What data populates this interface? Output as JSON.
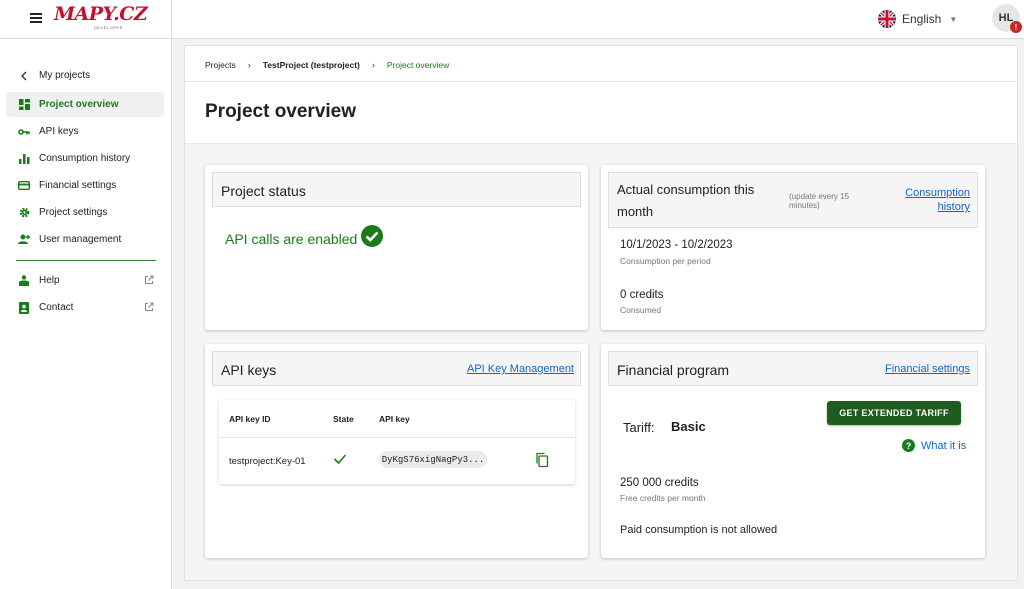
{
  "header": {
    "logo_text": "MAPY.CZ",
    "logo_sub": "DEVELOPER",
    "language": "English",
    "user_initials": "HL",
    "alert_badge": "!"
  },
  "sidebar": {
    "items": [
      {
        "label": "My projects",
        "icon": "chevron-left-icon"
      },
      {
        "label": "Project overview",
        "icon": "dashboard-icon"
      },
      {
        "label": "API keys",
        "icon": "key-icon"
      },
      {
        "label": "Consumption history",
        "icon": "bar-chart-icon"
      },
      {
        "label": "Financial settings",
        "icon": "credit-card-icon"
      },
      {
        "label": "Project settings",
        "icon": "gear-icon"
      },
      {
        "label": "User management",
        "icon": "user-management-icon"
      },
      {
        "label": "Help",
        "icon": "help-icon"
      },
      {
        "label": "Contact",
        "icon": "contact-icon"
      }
    ]
  },
  "breadcrumb": {
    "projects": "Projects",
    "project": "TestProject (testproject)",
    "current": "Project overview"
  },
  "page_title": "Project overview",
  "project_status": {
    "title": "Project status",
    "status_text": "API calls are enabled"
  },
  "consumption": {
    "title_line1": "Actual consumption this",
    "title_line2": "month",
    "note": "(update every 15 minutes)",
    "link_line1": "Consumption",
    "link_line2": "history",
    "period": "10/1/2023 - 10/2/2023",
    "period_label": "Consumption per period",
    "credits": "0 credits",
    "credits_label": "Consumed"
  },
  "api_keys": {
    "title": "API keys",
    "link": "API Key Management",
    "columns": [
      "API key ID",
      "State",
      "API key"
    ],
    "rows": [
      {
        "id": "testproject:Key-01",
        "key": "DyKgS76xigNagPy3..."
      }
    ]
  },
  "financial": {
    "title": "Financial program",
    "link": "Financial settings",
    "tariff_label": "Tariff:",
    "tariff_value": "Basic",
    "button": "GET EXTENDED TARIFF",
    "what_it_is": "What it is",
    "free_credits": "250 000 credits",
    "free_credits_label": "Free credits per month",
    "paid_note": "Paid consumption is not allowed"
  },
  "colors": {
    "accent_green": "#1b7a1b",
    "button_green": "#1f5c1f",
    "link_blue": "#1565c0",
    "alert_red": "#c62828"
  }
}
